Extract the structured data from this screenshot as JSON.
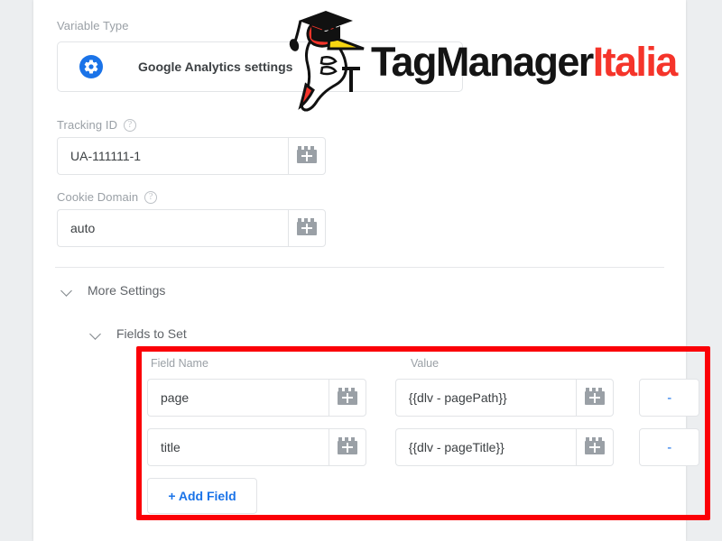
{
  "form": {
    "variable_type": {
      "label": "Variable Type",
      "value": "Google Analytics settings",
      "icon": "gear-icon"
    },
    "tracking_id": {
      "label": "Tracking ID",
      "help": "?",
      "value": "UA-111111-1",
      "picker_icon": "variable-picker-icon"
    },
    "cookie_domain": {
      "label": "Cookie Domain",
      "help": "?",
      "value": "auto",
      "picker_icon": "variable-picker-icon"
    }
  },
  "sections": {
    "more_settings": "More Settings",
    "fields_to_set": "Fields to Set"
  },
  "fields_table": {
    "headers": {
      "field_name": "Field Name",
      "value": "Value"
    },
    "rows": [
      {
        "field_name": "page",
        "value": "{{dlv - pagePath}}",
        "remove_label": "-"
      },
      {
        "field_name": "title",
        "value": "{{dlv - pageTitle}}",
        "remove_label": "-"
      }
    ],
    "add_field_label": "+ Add Field"
  },
  "logo": {
    "word_primary": "TagManager",
    "word_accent": "Italia",
    "accent_color": "#f5342a",
    "mark": "woodpecker-graduation-cap-icon"
  },
  "colors": {
    "accent_blue": "#1a73e8",
    "highlight_red": "#fb0007",
    "label_grey": "#9aa0a6",
    "page_background": "#eceef0"
  }
}
